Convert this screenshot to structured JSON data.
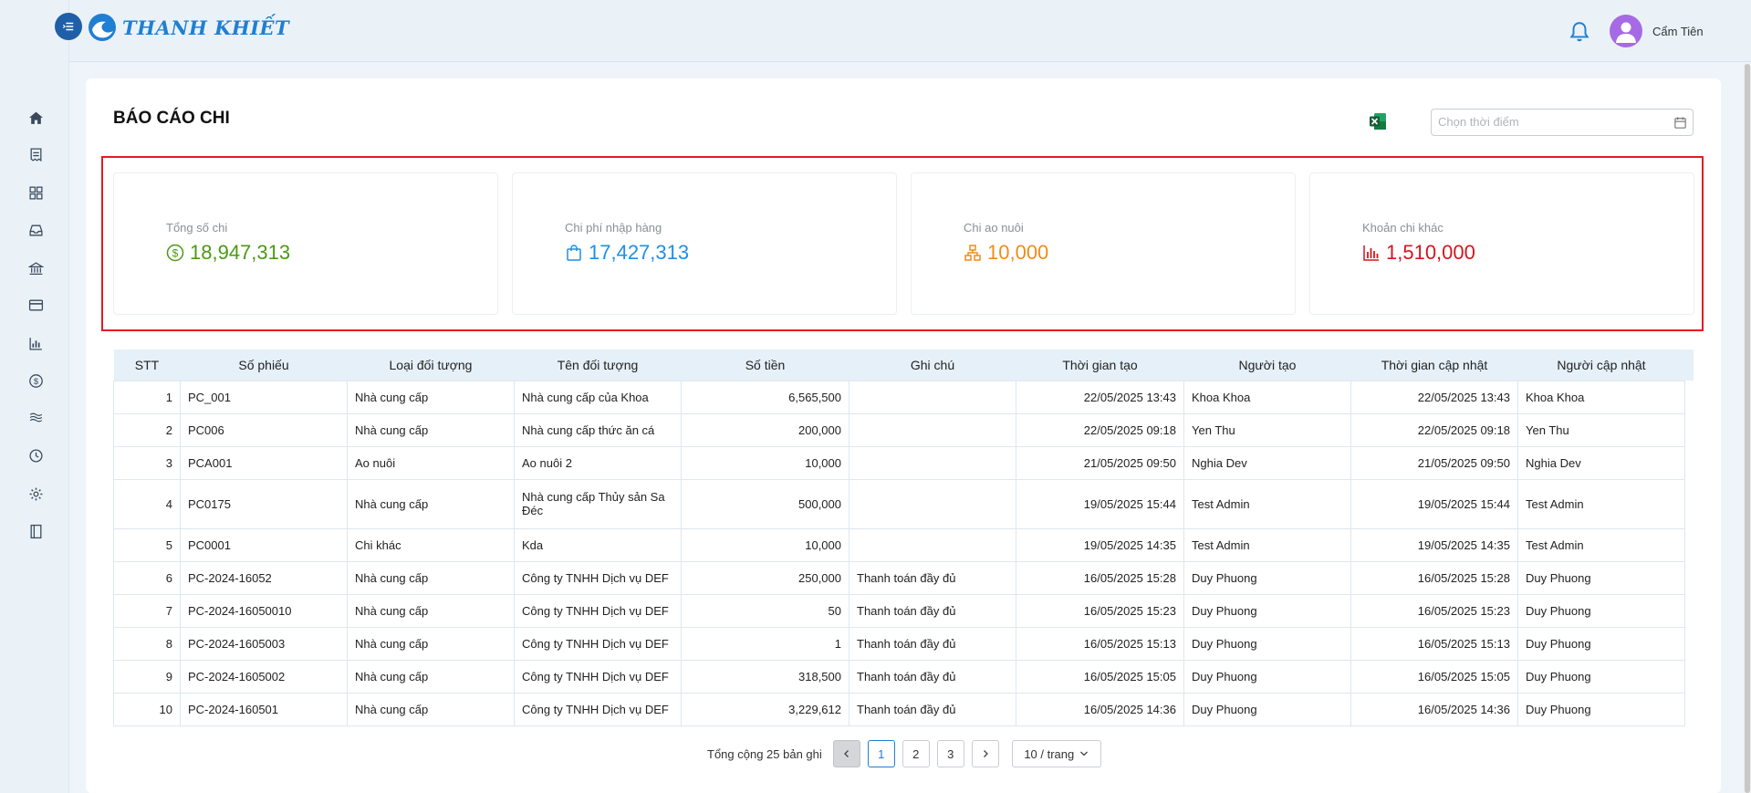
{
  "app": {
    "brand": "THANH KHIẾT",
    "user_name": "Cẩm Tiên"
  },
  "sidebar": {
    "items": [
      {
        "icon": "home-icon"
      },
      {
        "icon": "receipt-icon"
      },
      {
        "icon": "grid-icon"
      },
      {
        "icon": "inbox-icon"
      },
      {
        "icon": "bank-icon"
      },
      {
        "icon": "card-icon"
      },
      {
        "icon": "chart-icon"
      },
      {
        "icon": "dollar-icon"
      },
      {
        "icon": "waves-icon"
      },
      {
        "icon": "history-icon"
      },
      {
        "icon": "settings-icon"
      },
      {
        "icon": "book-icon"
      }
    ]
  },
  "page": {
    "title": "BÁO CÁO CHI",
    "date_placeholder": "Chọn thời điểm"
  },
  "stats": [
    {
      "label": "Tổng số chi",
      "value": "18,947,313",
      "color": "#4a9a16",
      "icon": "dollar-circle-icon"
    },
    {
      "label": "Chi phí nhập hàng",
      "value": "17,427,313",
      "color": "#1f8fe5",
      "icon": "shopping-bag-icon"
    },
    {
      "label": "Chi ao nuôi",
      "value": "10,000",
      "color": "#f08c1c",
      "icon": "cluster-icon"
    },
    {
      "label": "Khoản chi khác",
      "value": "1,510,000",
      "color": "#d4161c",
      "icon": "bar-chart-icon"
    }
  ],
  "table": {
    "columns": [
      "STT",
      "Số phiếu",
      "Loại đối tượng",
      "Tên đối tượng",
      "Số tiền",
      "Ghi chú",
      "Thời gian tạo",
      "Người tạo",
      "Thời gian cập nhật",
      "Người cập nhật"
    ],
    "rows": [
      [
        "1",
        "PC_001",
        "Nhà cung cấp",
        "Nhà cung cấp của Khoa",
        "6,565,500",
        "",
        "22/05/2025 13:43",
        "Khoa Khoa",
        "22/05/2025 13:43",
        "Khoa Khoa"
      ],
      [
        "2",
        "PC006",
        "Nhà cung cấp",
        "Nhà cung cấp thức ăn cá",
        "200,000",
        "",
        "22/05/2025 09:18",
        "Yen Thu",
        "22/05/2025 09:18",
        "Yen Thu"
      ],
      [
        "3",
        "PCA001",
        "Ao nuôi",
        "Ao nuôi 2",
        "10,000",
        "",
        "21/05/2025 09:50",
        "Nghia Dev",
        "21/05/2025 09:50",
        "Nghia Dev"
      ],
      [
        "4",
        "PC0175",
        "Nhà cung cấp",
        "Nhà cung cấp Thủy sản Sa Đéc",
        "500,000",
        "",
        "19/05/2025 15:44",
        "Test Admin",
        "19/05/2025 15:44",
        "Test Admin"
      ],
      [
        "5",
        "PC0001",
        "Chi khác",
        "Kda",
        "10,000",
        "",
        "19/05/2025 14:35",
        "Test Admin",
        "19/05/2025 14:35",
        "Test Admin"
      ],
      [
        "6",
        "PC-2024-16052",
        "Nhà cung cấp",
        "Công ty TNHH Dịch vụ DEF",
        "250,000",
        "Thanh toán đầy đủ",
        "16/05/2025 15:28",
        "Duy Phuong",
        "16/05/2025 15:28",
        "Duy Phuong"
      ],
      [
        "7",
        "PC-2024-16050010",
        "Nhà cung cấp",
        "Công ty TNHH Dịch vụ DEF",
        "50",
        "Thanh toán đầy đủ",
        "16/05/2025 15:23",
        "Duy Phuong",
        "16/05/2025 15:23",
        "Duy Phuong"
      ],
      [
        "8",
        "PC-2024-1605003",
        "Nhà cung cấp",
        "Công ty TNHH Dịch vụ DEF",
        "1",
        "Thanh toán đầy đủ",
        "16/05/2025 15:13",
        "Duy Phuong",
        "16/05/2025 15:13",
        "Duy Phuong"
      ],
      [
        "9",
        "PC-2024-1605002",
        "Nhà cung cấp",
        "Công ty TNHH Dịch vụ DEF",
        "318,500",
        "Thanh toán đầy đủ",
        "16/05/2025 15:05",
        "Duy Phuong",
        "16/05/2025 15:05",
        "Duy Phuong"
      ],
      [
        "10",
        "PC-2024-160501",
        "Nhà cung cấp",
        "Công ty TNHH Dịch vụ DEF",
        "3,229,612",
        "Thanh toán đầy đủ",
        "16/05/2025 14:36",
        "Duy Phuong",
        "16/05/2025 14:36",
        "Duy Phuong"
      ]
    ]
  },
  "pagination": {
    "total_text": "Tổng cộng 25 bản ghi",
    "pages": [
      "1",
      "2",
      "3"
    ],
    "current": "1",
    "page_size": "10 / trang"
  }
}
